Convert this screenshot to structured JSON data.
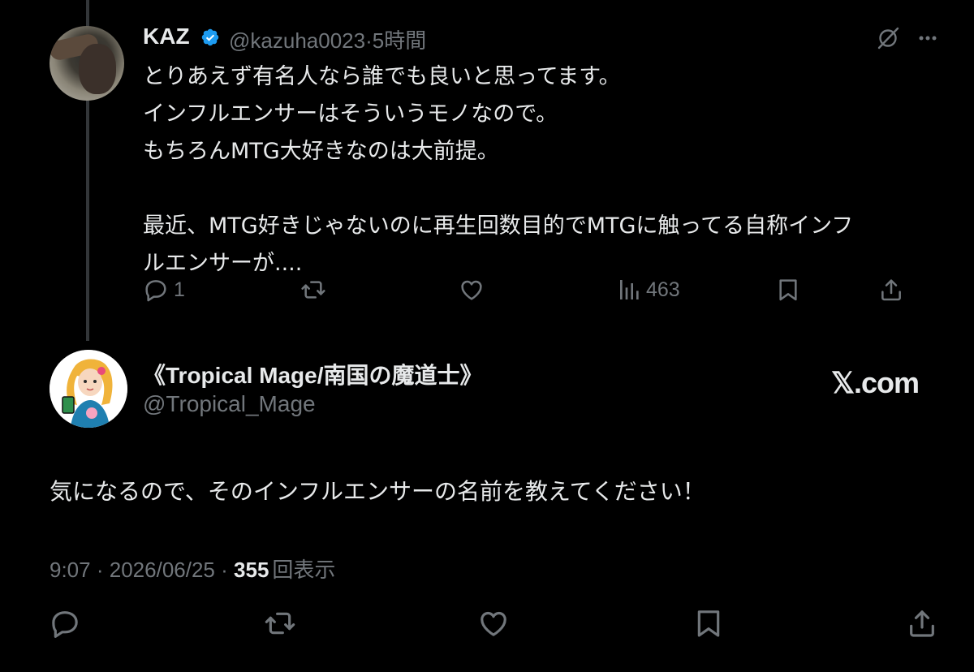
{
  "reply_context": {
    "author": {
      "name": "KAZ",
      "handle": "@kazuha0023",
      "time": "5時間",
      "separator": "·"
    },
    "text": "とりあえず有名人なら誰でも良いと思ってます。\nインフルエンサーはそういうモノなので。\nもちろんMTG大好きなのは大前提。\n\n最近、MTG好きじゃないのに再生回数目的でMTGに触ってる自称インフ\nルエンサーが....",
    "stats": {
      "replies": "1",
      "views": "463"
    },
    "icons": [
      "reply-icon",
      "repost-icon",
      "like-icon",
      "views-icon",
      "bookmark-icon",
      "share-icon",
      "grok-icon",
      "more-icon"
    ]
  },
  "main_post": {
    "author": {
      "name": "《Tropical Mage/南国の魔道士》",
      "handle": "@Tropical_Mage"
    },
    "watermark": "𝕏.com",
    "text": "気になるので、そのインフルエンサーの名前を教えてください！",
    "meta": {
      "time": "9:07",
      "date": "2026/06/25",
      "separator": "·",
      "views_count": "355",
      "views_label": "回表示"
    }
  },
  "colors": {
    "background": "#000000",
    "text": "#e7e9ea",
    "muted": "#71767b",
    "verified": "#1d9bf0",
    "thread_line": "#333639"
  }
}
